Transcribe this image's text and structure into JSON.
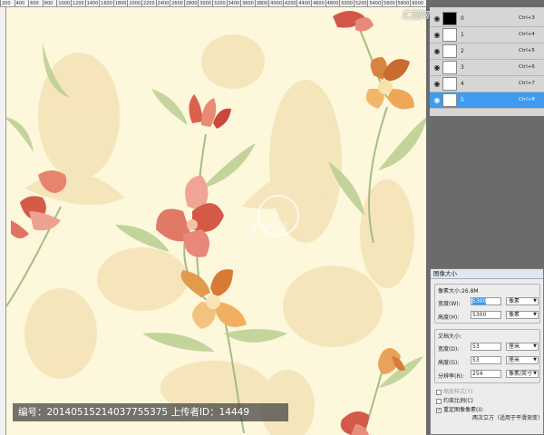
{
  "ruler": {
    "ticks": [
      "200",
      "400",
      "600",
      "800",
      "1000",
      "1200",
      "1400",
      "1600",
      "1800",
      "2000",
      "2200",
      "2400",
      "2600",
      "2800",
      "3000",
      "3200",
      "3400",
      "3600",
      "3800",
      "4000",
      "4200",
      "4400",
      "4600",
      "4800",
      "5000",
      "5200",
      "5400",
      "5600",
      "5800",
      "6000"
    ]
  },
  "watermark": {
    "site": "汇图网 www.huitu.com",
    "caption": "编号：20140515214037755375 上传者ID：14449"
  },
  "layers": [
    {
      "name": "0",
      "shortcut": "Ctrl+3",
      "thumb": "black",
      "selected": false
    },
    {
      "name": "1",
      "shortcut": "Ctrl+4",
      "thumb": "white",
      "selected": false
    },
    {
      "name": "2",
      "shortcut": "Ctrl+5",
      "thumb": "white",
      "selected": false
    },
    {
      "name": "3",
      "shortcut": "Ctrl+6",
      "thumb": "white",
      "selected": false
    },
    {
      "name": "4",
      "shortcut": "Ctrl+7",
      "thumb": "white",
      "selected": false
    },
    {
      "name": "5",
      "shortcut": "Ctrl+8",
      "thumb": "white",
      "selected": true
    }
  ],
  "dialog": {
    "title": "图像大小",
    "pixel_size": "像素大小:26.8M",
    "width_label": "宽度(W):",
    "width_value": "5300",
    "width_unit": "像素",
    "height_label": "高度(H):",
    "height_value": "5300",
    "height_unit": "像素",
    "doc_size": "文档大小:",
    "doc_width_label": "宽度(D):",
    "doc_width_value": "53",
    "doc_width_unit": "厘米",
    "doc_height_label": "高度(G):",
    "doc_height_value": "53",
    "doc_height_unit": "厘米",
    "resolution_label": "分辨率(R):",
    "resolution_value": "254",
    "resolution_unit": "像素/英寸",
    "scale_styles": "缩放样式(Y)",
    "constrain": "约束比例(C)",
    "resample": "重定图像像素(I):",
    "resample_method": "两次立方（适用于平滑渐变）"
  },
  "colors": {
    "canvas_bg": "#fdf7dc",
    "selection_blue": "#3e9bf0",
    "app_gray": "#6b6b6b"
  }
}
